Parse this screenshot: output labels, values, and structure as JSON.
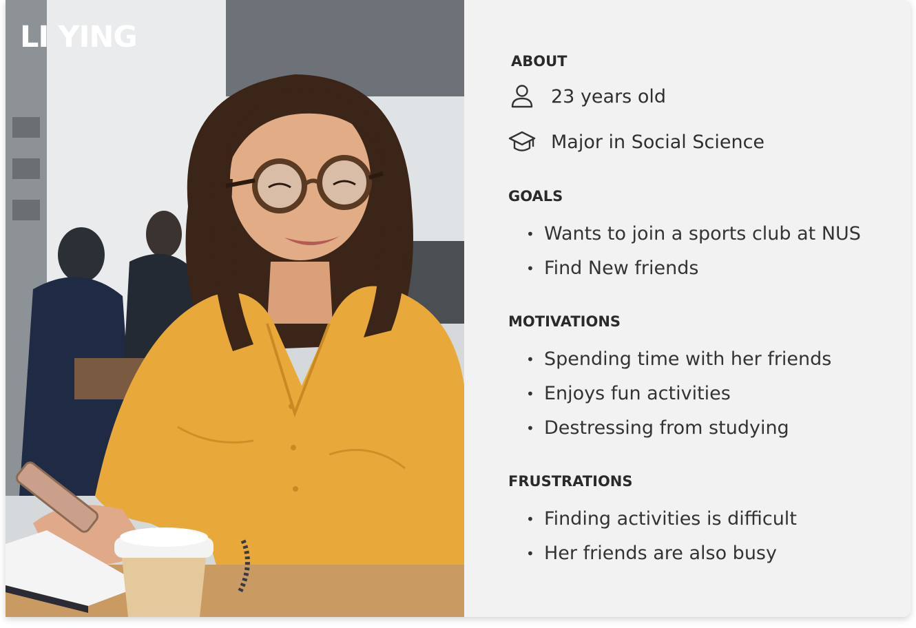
{
  "persona": {
    "name": "LI YING"
  },
  "about": {
    "title": "ABOUT",
    "age": {
      "icon": "person-icon",
      "text": "23 years old"
    },
    "major": {
      "icon": "graduation-cap-icon",
      "text": "Major in Social Science"
    }
  },
  "goals": {
    "title": "GOALS",
    "items": [
      "Wants to join a sports club at NUS",
      "Find New friends"
    ]
  },
  "motivations": {
    "title": "MOTIVATIONS",
    "items": [
      "Spending time with her friends",
      "Enjoys fun activities",
      "Destressing from studying"
    ]
  },
  "frustrations": {
    "title": "FRUSTRATIONS",
    "items": [
      "Finding activities is difficult",
      "Her friends are also busy"
    ]
  },
  "colors": {
    "panel_background": "#f2f2f2",
    "text": "#2f2f2f",
    "shirt": "#e8a93a"
  }
}
